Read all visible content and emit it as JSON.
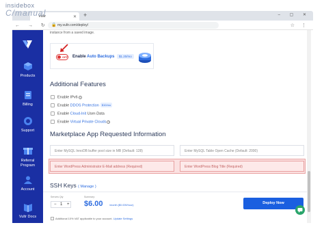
{
  "watermark": {
    "line1": "insidebox",
    "line2": "C/manual"
  },
  "browser": {
    "tab_title": "Vultr",
    "new_tab": "+",
    "window_controls": "– ▢ ✕",
    "nav_buttons": "← → ↻",
    "url": "my.vultr.com/deploy/",
    "tools": "☆ ⋮"
  },
  "sidebar": {
    "items": [
      {
        "label": "Products",
        "icon": "cube-icon"
      },
      {
        "label": "Billing",
        "icon": "billing-icon"
      },
      {
        "label": "Support",
        "icon": "support-icon"
      },
      {
        "label": "Referral\nProgram",
        "icon": "referral-icon"
      },
      {
        "label": "Account",
        "icon": "account-icon"
      },
      {
        "label": "Vultr Docs",
        "icon": "docs-icon"
      }
    ]
  },
  "main": {
    "intro_text": "instance from a saved image.",
    "backups": {
      "label_prefix": "Enable",
      "label_link": "Auto Backups",
      "price": "$1.20/mo",
      "toggle_state": "off",
      "toggle_text": "OFF"
    },
    "additional_features": {
      "title": "Additional Features",
      "items": [
        {
          "prefix": "Enable",
          "link": "",
          "text": "IPv6",
          "help": true
        },
        {
          "prefix": "Enable",
          "link": "DDOS Protection",
          "text": "",
          "badge": "$10/mo"
        },
        {
          "prefix": "Enable",
          "link": "Cloud-Init",
          "text": "User-Data",
          "help": false
        },
        {
          "prefix": "Enable",
          "link": "Virtual Private Clouds",
          "text": "",
          "help": true
        }
      ]
    },
    "marketplace": {
      "title": "Marketplace App Requested Information",
      "fields": [
        {
          "placeholder": "Enter MySQL InnoDB buffer pool size in MB (Default: 128)",
          "error": false
        },
        {
          "placeholder": "Enter MySQL Table Open Cache (Default: 2000)",
          "error": false
        },
        {
          "placeholder": "Enter WordPress Administrator E-Mail address (Required)",
          "error": true
        },
        {
          "placeholder": "Enter WordPress Blog Title (Required)",
          "error": true
        }
      ]
    },
    "ssh": {
      "title": "SSH Keys",
      "manage": "( Manage )"
    },
    "footer": {
      "qty_label": "Servers Qty",
      "qty_minus": "−",
      "qty_value": "1",
      "qty_plus": "+",
      "summary_label": "Summary:",
      "price": "$6.00",
      "per": "/month ($0.009/hour)",
      "vat_text": "Additional 10% VAT applicable to your account.",
      "vat_link": "Update Settings",
      "deploy_label": "Deploy Now"
    }
  },
  "colors": {
    "sidebar": "#1a2fa3",
    "accent": "#2d6cdf",
    "error": "#e9a2a2",
    "deploy": "#1a5fe0",
    "chat": "#2aa56b"
  }
}
